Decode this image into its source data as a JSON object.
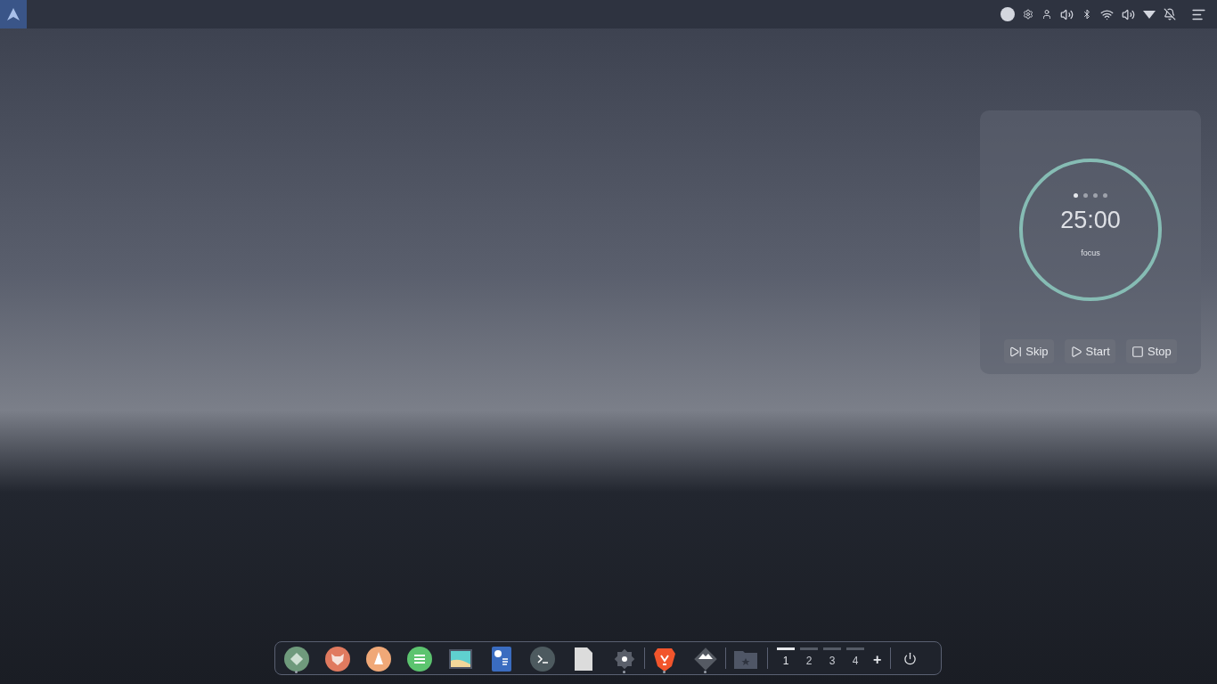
{
  "timer": {
    "stages": [
      {
        "selected": true
      },
      {
        "selected": false
      },
      {
        "selected": false
      },
      {
        "selected": false
      }
    ],
    "time": "25:00",
    "mode": "focus",
    "buttons": [
      {
        "kind": "skip",
        "label": "Skip"
      },
      {
        "kind": "start",
        "label": "Start"
      },
      {
        "kind": "stop",
        "label": "Stop"
      }
    ]
  },
  "dock": {
    "groups": [
      [
        {
          "kind": "diamond",
          "running": true
        },
        {
          "kind": "fox",
          "running": false
        },
        {
          "kind": "cone",
          "running": false
        },
        {
          "kind": "lines",
          "running": false
        },
        {
          "kind": "picture",
          "running": false
        },
        {
          "kind": "document",
          "running": false
        },
        {
          "kind": "terminal",
          "running": false
        },
        {
          "kind": "file",
          "running": false
        },
        {
          "kind": "gear",
          "running": true
        }
      ],
      [
        {
          "kind": "lion",
          "running": true
        },
        {
          "kind": "mountain",
          "running": true
        }
      ],
      [
        {
          "kind": "folder",
          "running": false
        }
      ]
    ],
    "workspaces": [
      {
        "label": "1",
        "selected": true
      },
      {
        "label": "2",
        "selected": false
      },
      {
        "label": "3",
        "selected": false
      },
      {
        "label": "4",
        "selected": false
      }
    ],
    "add_label": "+"
  }
}
